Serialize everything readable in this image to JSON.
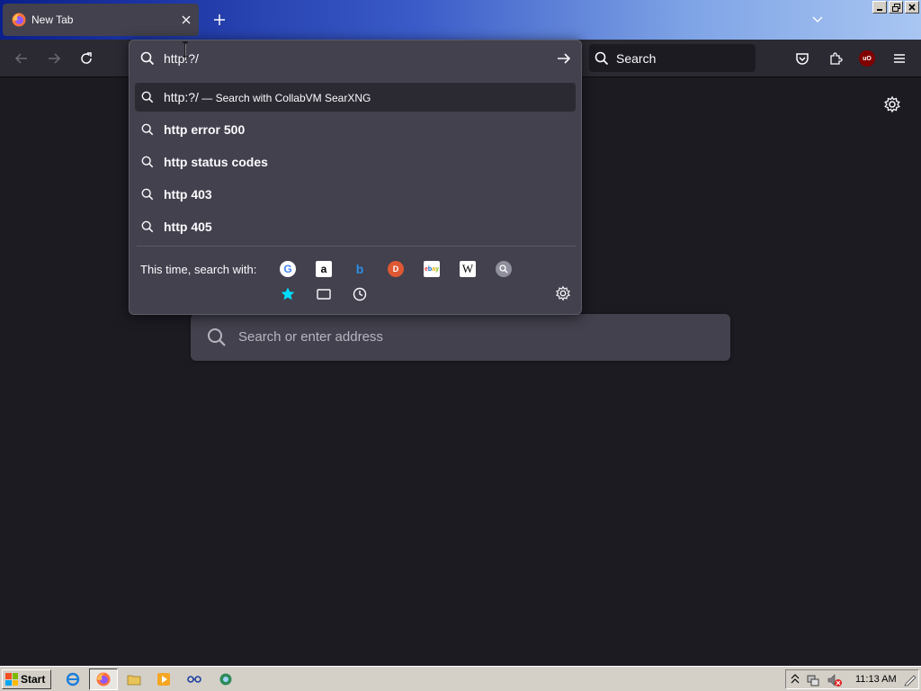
{
  "browser": {
    "tab": {
      "title": "New Tab"
    },
    "searchbar": {
      "placeholder": "Search"
    },
    "urlbar": {
      "value": "http:?/",
      "results": [
        {
          "text": "http:?/",
          "sub": " — Search with CollabVM SearXNG",
          "selected": true
        },
        {
          "text": "http error 500"
        },
        {
          "text": "http status codes"
        },
        {
          "text": "http 403"
        },
        {
          "text": "http 405"
        }
      ],
      "onesearch_label": "This time, search with:",
      "engines": [
        "Google",
        "Amazon",
        "Bing",
        "DuckDuckGo",
        "eBay",
        "Wikipedia",
        "Search engine"
      ],
      "search_modes": [
        "bookmarks-star-icon",
        "tabs-icon",
        "history-clock-icon"
      ]
    },
    "newtab": {
      "search_placeholder": "Search or enter address"
    }
  },
  "taskbar": {
    "start_label": "Start",
    "clock": "11:13 AM"
  },
  "colors": {
    "page_bg": "#1c1b22",
    "toolbar_bg": "#2b2a33",
    "panel_bg": "#42414d",
    "accent_star": "#00ddff"
  }
}
